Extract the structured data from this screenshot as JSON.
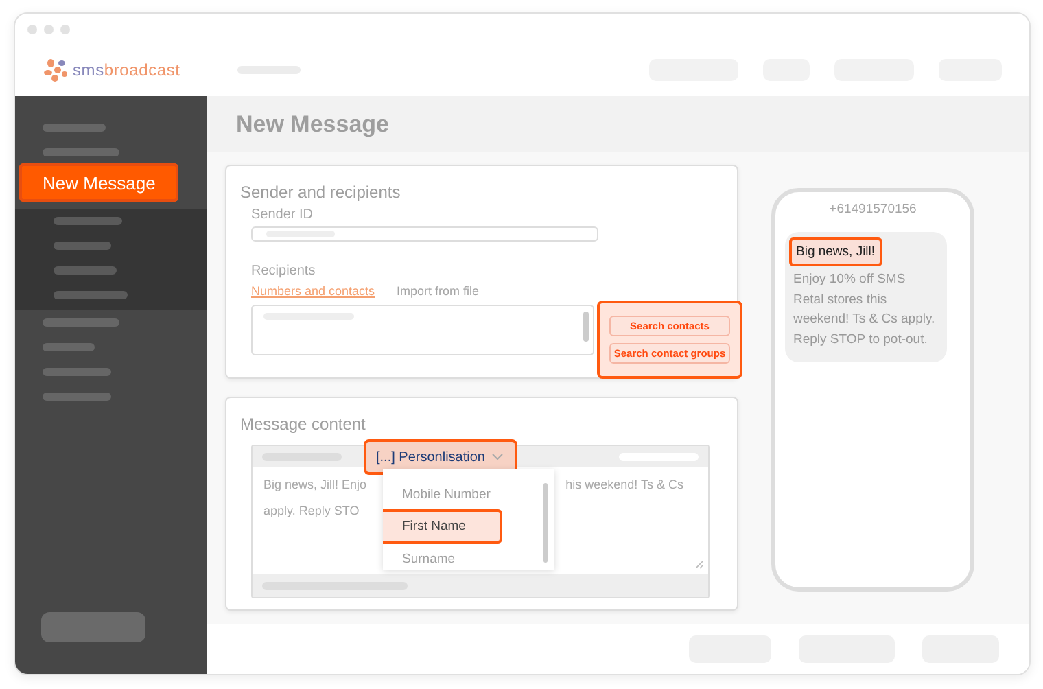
{
  "header": {
    "logo": {
      "prefix": "sms",
      "suffix": "broadcast"
    }
  },
  "sidebar": {
    "items": [
      {
        "label": "New Message",
        "selected": true,
        "highlighted": true
      }
    ]
  },
  "page_title": "New Message",
  "sender_card": {
    "title": "Sender and recipients",
    "sender_id_label": "Sender ID",
    "recipients_label": "Recipients",
    "recipient_tabs": [
      {
        "label": "Numbers and contacts",
        "selected": true
      },
      {
        "label": "Import from file",
        "selected": false
      }
    ],
    "buttons": [
      {
        "label": "Search contacts"
      },
      {
        "label": "Search contact groups"
      }
    ],
    "buttons_highlighted": true
  },
  "message_card": {
    "title": "Message content",
    "personalisation": {
      "label": "[...] Personlisation",
      "expanded": true,
      "highlighted": true
    },
    "menu_items": [
      {
        "label": "Mobile Number",
        "selected": false
      },
      {
        "label": "First Name",
        "selected": true
      },
      {
        "label": "Surname",
        "selected": false
      }
    ],
    "text_lines": [
      {
        "left": "Big news, Jill! Enjo",
        "right": "his weekend! Ts & Cs"
      },
      {
        "left": "apply. Reply STO"
      }
    ]
  },
  "phone": {
    "number": "+61491570156",
    "highlight": "Big news, Jill!",
    "message": "Enjoy 10% off SMS Retal stores this weekend! Ts & Cs apply. Reply STOP to pot-out."
  }
}
